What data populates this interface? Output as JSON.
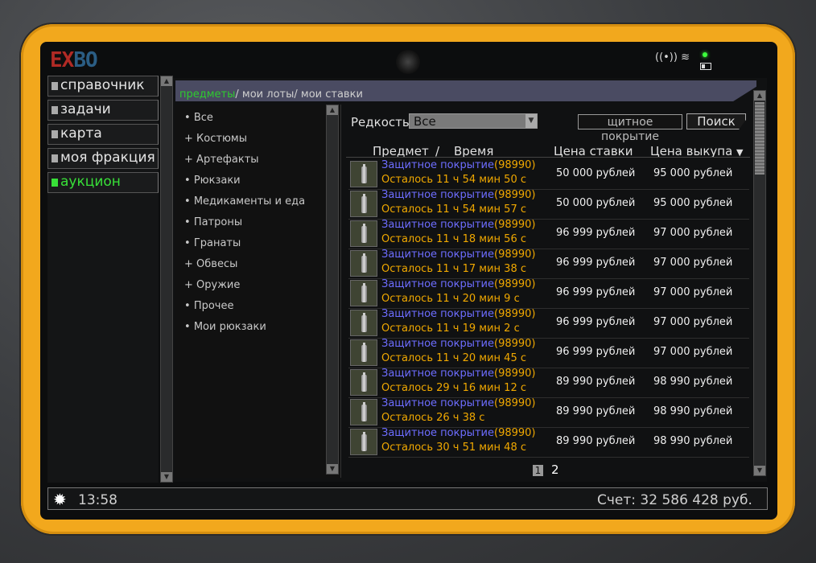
{
  "logo": {
    "part1": "EX",
    "part2": "BO"
  },
  "nav": [
    {
      "label": "справочник"
    },
    {
      "label": "задачи"
    },
    {
      "label": "карта"
    },
    {
      "label": "моя фракция"
    },
    {
      "label": "аукцион"
    }
  ],
  "tabs": {
    "items": "предметы",
    "sep1": "/",
    "my_lots": "мои лоты",
    "sep2": "/",
    "my_bids": "мои ставки"
  },
  "categories": [
    {
      "prefix": "•",
      "label": "Все"
    },
    {
      "prefix": "+",
      "label": "Костюмы"
    },
    {
      "prefix": "+",
      "label": "Артефакты"
    },
    {
      "prefix": "•",
      "label": "Рюкзаки"
    },
    {
      "prefix": "•",
      "label": "Медикаменты и еда"
    },
    {
      "prefix": "•",
      "label": "Патроны"
    },
    {
      "prefix": "•",
      "label": "Гранаты"
    },
    {
      "prefix": "+",
      "label": "Обвесы"
    },
    {
      "prefix": "+",
      "label": "Оружие"
    },
    {
      "prefix": "•",
      "label": "Прочее"
    },
    {
      "prefix": "•",
      "label": "Мои рюкзаки"
    }
  ],
  "filter": {
    "rarity_label": "Редкость",
    "rarity_value": "Все",
    "search_value": "щитное покрытие",
    "search_button": "Поиск"
  },
  "headers": {
    "item": "Предмет",
    "sep": "/",
    "time": "Время",
    "bid": "Цена ставки",
    "buyout": "Цена выкупа",
    "sort": "▼"
  },
  "rows": [
    {
      "name": "Защитное покрытие",
      "id": "(98990)",
      "time": "Осталось 11 ч 54 мин 50 с",
      "bid": "50 000 рублей",
      "buyout": "95 000 рублей"
    },
    {
      "name": "Защитное покрытие",
      "id": "(98990)",
      "time": "Осталось 11 ч 54 мин 57 с",
      "bid": "50 000 рублей",
      "buyout": "95 000 рублей"
    },
    {
      "name": "Защитное покрытие",
      "id": "(98990)",
      "time": "Осталось 11 ч 18 мин 56 с",
      "bid": "96 999 рублей",
      "buyout": "97 000 рублей"
    },
    {
      "name": "Защитное покрытие",
      "id": "(98990)",
      "time": "Осталось 11 ч 17 мин 38 с",
      "bid": "96 999 рублей",
      "buyout": "97 000 рублей"
    },
    {
      "name": "Защитное покрытие",
      "id": "(98990)",
      "time": "Осталось 11 ч 20 мин 9 с",
      "bid": "96 999 рублей",
      "buyout": "97 000 рублей"
    },
    {
      "name": "Защитное покрытие",
      "id": "(98990)",
      "time": "Осталось 11 ч 19 мин 2 с",
      "bid": "96 999 рублей",
      "buyout": "97 000 рублей"
    },
    {
      "name": "Защитное покрытие",
      "id": "(98990)",
      "time": "Осталось 11 ч 20 мин 45 с",
      "bid": "96 999 рублей",
      "buyout": "97 000 рублей"
    },
    {
      "name": "Защитное покрытие",
      "id": "(98990)",
      "time": "Осталось 29 ч 16 мин 12 с",
      "bid": "89 990 рублей",
      "buyout": "98 990 рублей"
    },
    {
      "name": "Защитное покрытие",
      "id": "(98990)",
      "time": "Осталось 26 ч 38 с",
      "bid": "89 990 рублей",
      "buyout": "98 990 рублей"
    },
    {
      "name": "Защитное покрытие",
      "id": "(98990)",
      "time": "Осталось 30 ч 51 мин 48 с",
      "bid": "89 990 рублей",
      "buyout": "98 990 рублей"
    }
  ],
  "pagination": {
    "current": "1",
    "next": "2"
  },
  "status": {
    "time": "13:58",
    "balance": "Счет: 32 586 428 руб."
  },
  "colors": {
    "frame": "#f2a81d",
    "active_nav": "#38e038",
    "item_name": "#6d6dff",
    "time_text": "#f0a800"
  }
}
